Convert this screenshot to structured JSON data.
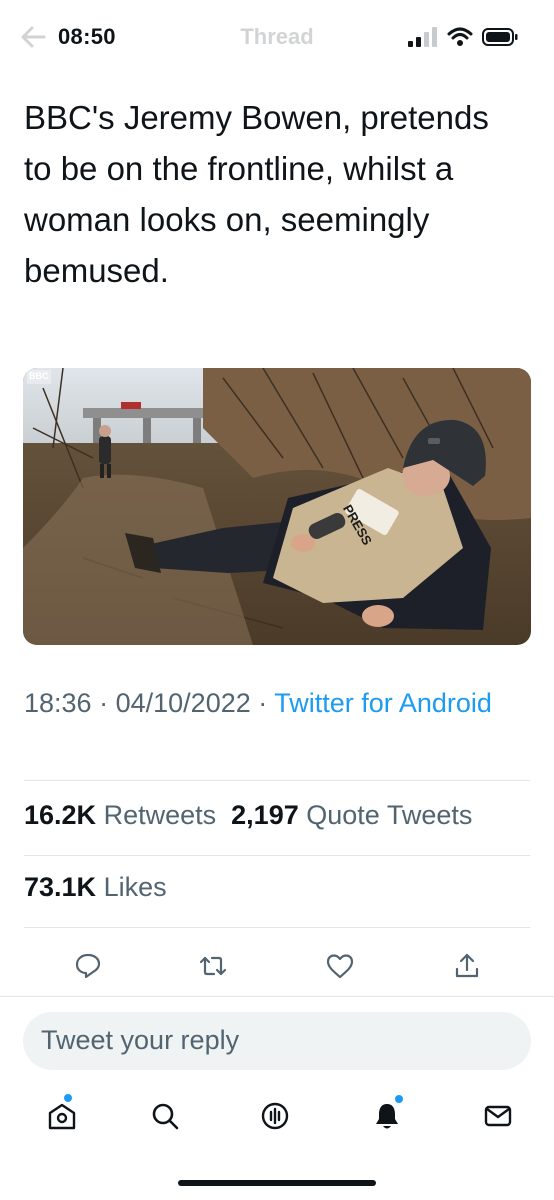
{
  "status_bar": {
    "time": "08:50",
    "faded_header_title": "Thread",
    "icons": [
      "cellular-signal-icon",
      "wifi-icon",
      "battery-icon"
    ]
  },
  "tweet": {
    "text": "BBC's Jeremy Bowen, pretends to be on the frontline, whilst a woman looks on, seemingly bemused.",
    "media": {
      "watermark": "BBC",
      "vest_label": "PRESS"
    },
    "time": "18:36",
    "separator": "·",
    "date": "04/10/2022",
    "source": "Twitter for Android"
  },
  "stats": {
    "retweets_count": "16.2K",
    "retweets_label": "Retweets",
    "quotes_count": "2,197",
    "quotes_label": "Quote Tweets",
    "likes_count": "73.1K",
    "likes_label": "Likes"
  },
  "actions": [
    "reply-icon",
    "retweet-icon",
    "like-icon",
    "share-icon"
  ],
  "reply": {
    "placeholder": "Tweet your reply"
  },
  "tab_bar": [
    "home-icon",
    "search-icon",
    "spaces-icon",
    "notifications-icon",
    "messages-icon"
  ],
  "colors": {
    "accent": "#1d9bf0",
    "text": "#0f1419",
    "secondary": "#536471",
    "divider": "#e1e6ea"
  }
}
